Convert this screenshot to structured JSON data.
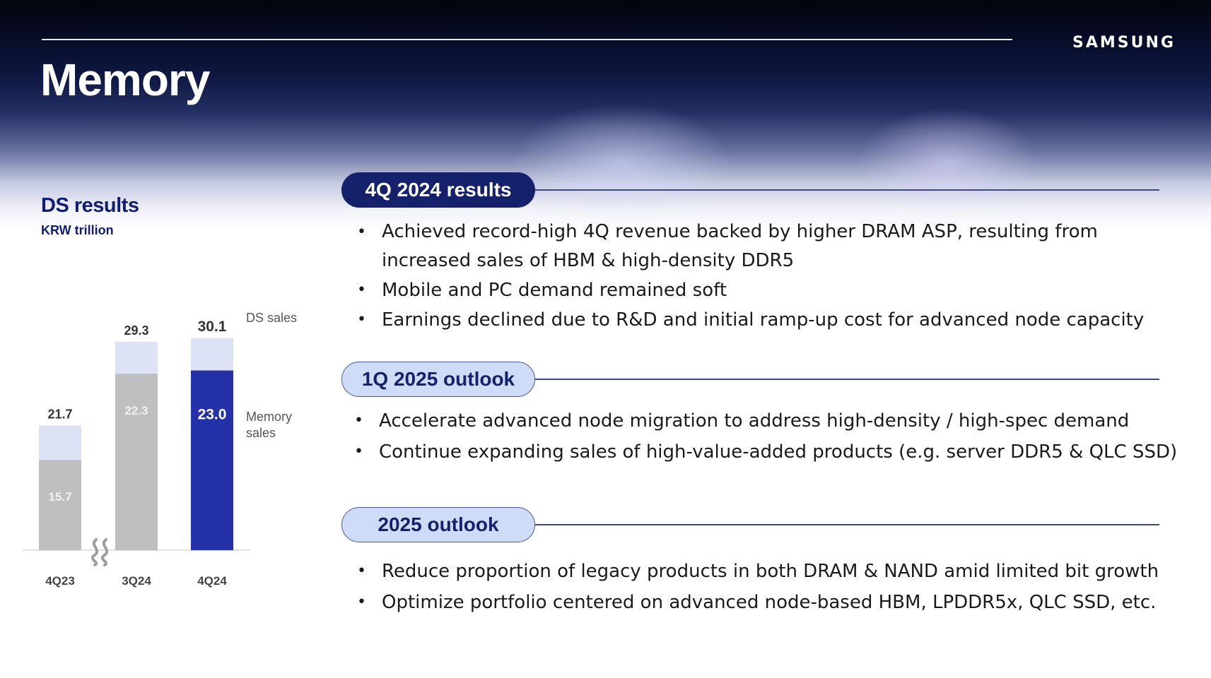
{
  "header": {
    "title": "Memory",
    "logo_text": "SAMSUNG"
  },
  "chart_panel": {
    "title": "DS results",
    "unit": "KRW trillion"
  },
  "chart_data": {
    "type": "bar",
    "title": "DS results",
    "ylabel": "KRW trillion",
    "categories": [
      "4Q23",
      "3Q24",
      "4Q24"
    ],
    "series": [
      {
        "name": "DS sales",
        "values": [
          21.7,
          29.3,
          30.1
        ]
      },
      {
        "name": "Memory sales",
        "values": [
          15.7,
          22.3,
          23.0
        ]
      }
    ],
    "value_labels_total": [
      "21.7",
      "29.3",
      "30.1"
    ],
    "value_labels_memory": [
      "15.7",
      "22.3",
      "23.0"
    ],
    "legend_labels": {
      "total": "DS sales",
      "memory_line1": "Memory",
      "memory_line2": "sales"
    },
    "axis_break_between": [
      "4Q23",
      "3Q24"
    ],
    "colors": {
      "total_fill": "#dde3f4",
      "memory_fill": "#bfbfbf",
      "highlight_memory_fill": "#2531a8",
      "label_dark": "#333333",
      "label_light": "#f2f2f2"
    }
  },
  "sections": [
    {
      "heading": "4Q 2024 results",
      "style": "dark",
      "bullets": [
        "Achieved record-high 4Q revenue backed by higher DRAM ASP, resulting from increased sales of HBM & high-density DDR5",
        "Mobile and PC demand remained soft",
        "Earnings declined due to R&D and initial ramp-up cost for advanced node capacity"
      ]
    },
    {
      "heading": "1Q 2025 outlook",
      "style": "light",
      "bullets": [
        "Accelerate advanced node migration to address high-density / high-spec demand",
        "Continue expanding sales of high-value-added products (e.g. server DDR5 & QLC SSD)"
      ]
    },
    {
      "heading": "2025 outlook",
      "style": "light",
      "bullets": [
        "Reduce proportion of legacy products in both DRAM & NAND amid limited bit growth",
        "Optimize portfolio centered on advanced node-based HBM, LPDDR5x, QLC SSD, etc."
      ]
    }
  ]
}
